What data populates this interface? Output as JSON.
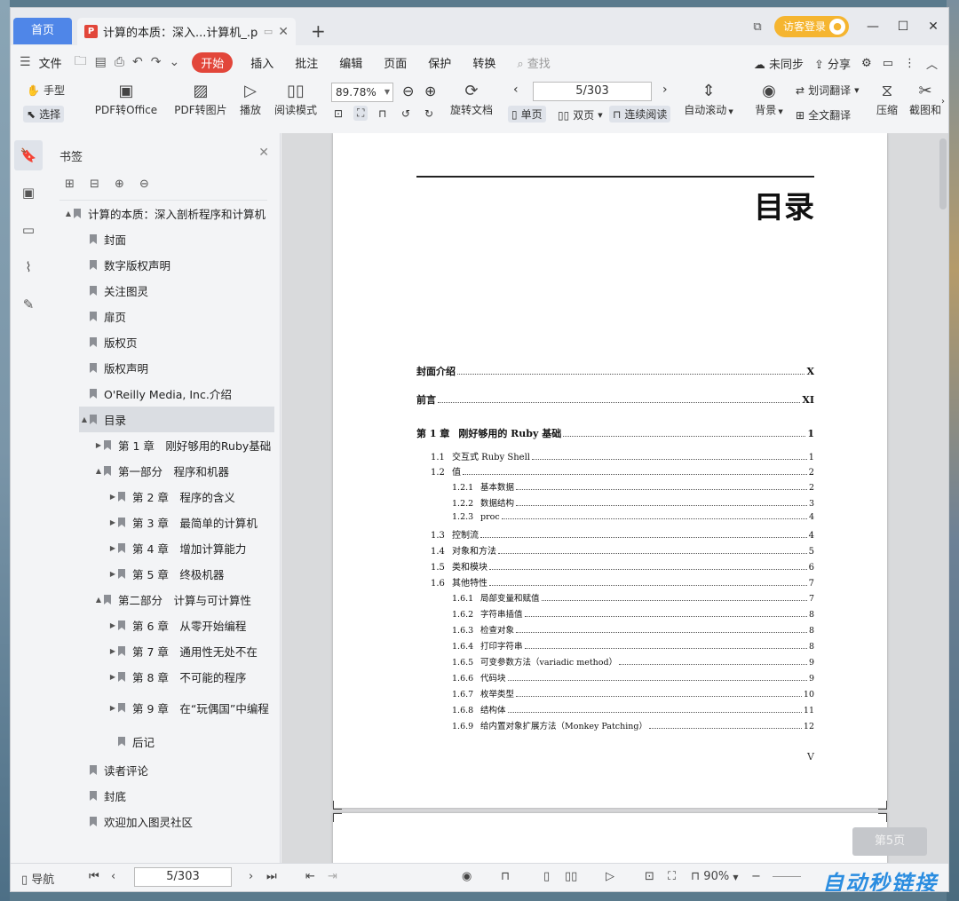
{
  "titlebar": {
    "home_tab": "首页",
    "doc_tab_title": "计算的本质：深入...计算机_.pdf",
    "pdf_icon": "pdf-icon",
    "login_label": "访客登录"
  },
  "menu": {
    "file": "文件",
    "start": "开始",
    "items": [
      "插入",
      "批注",
      "编辑",
      "页面",
      "保护",
      "转换"
    ],
    "search": "查找",
    "sync": "未同步",
    "share": "分享"
  },
  "toolbar": {
    "hand": "手型",
    "select": "选择",
    "pdf_to_office": "PDF转Office",
    "pdf_to_image": "PDF转图片",
    "play": "播放",
    "read_mode": "阅读模式",
    "zoom": "89.78%",
    "rotate": "旋转文档",
    "page_value": "5/303",
    "single": "单页",
    "double": "双页",
    "continuous": "连续阅读",
    "auto_scroll": "自动滚动",
    "background": "背景",
    "word_translate": "划词翻译",
    "full_translate": "全文翻译",
    "compress": "压缩",
    "screenshot": "截图和"
  },
  "sidebar": {
    "title": "书签",
    "tree": [
      {
        "label": "计算的本质：深入剖析程序和计算机",
        "level": 0,
        "arrow": "▲"
      },
      {
        "label": "封面",
        "level": 1,
        "arrow": ""
      },
      {
        "label": "数字版权声明",
        "level": 1,
        "arrow": ""
      },
      {
        "label": "关注图灵",
        "level": 1,
        "arrow": ""
      },
      {
        "label": "扉页",
        "level": 1,
        "arrow": ""
      },
      {
        "label": "版权页",
        "level": 1,
        "arrow": ""
      },
      {
        "label": "版权声明",
        "level": 1,
        "arrow": ""
      },
      {
        "label": "O'Reilly Media, Inc.介绍",
        "level": 1,
        "arrow": ""
      },
      {
        "label": "目录",
        "level": 1,
        "arrow": "▲",
        "selected": true
      },
      {
        "label": "第 1 章　刚好够用的Ruby基础",
        "level": 2,
        "arrow": "▶"
      },
      {
        "label": "第一部分　程序和机器",
        "level": 2,
        "arrow": "▲"
      },
      {
        "label": "第 2 章　程序的含义",
        "level": 3,
        "arrow": "▶"
      },
      {
        "label": "第 3 章　最简单的计算机",
        "level": 3,
        "arrow": "▶"
      },
      {
        "label": "第 4 章　增加计算能力",
        "level": 3,
        "arrow": "▶"
      },
      {
        "label": "第 5 章　终极机器",
        "level": 3,
        "arrow": "▶"
      },
      {
        "label": "第二部分　计算与可计算性",
        "level": 2,
        "arrow": "▲"
      },
      {
        "label": "第 6 章　从零开始编程",
        "level": 3,
        "arrow": "▶"
      },
      {
        "label": "第 7 章　通用性无处不在",
        "level": 3,
        "arrow": "▶"
      },
      {
        "label": "第 8 章　不可能的程序",
        "level": 3,
        "arrow": "▶"
      },
      {
        "label": "第 9 章　在“玩偶国”中编程",
        "level": 3,
        "arrow": "▶"
      },
      {
        "label": "后记",
        "level": 3,
        "arrow": ""
      },
      {
        "label": "读者评论",
        "level": 1,
        "arrow": ""
      },
      {
        "label": "封底",
        "level": 1,
        "arrow": ""
      },
      {
        "label": "欢迎加入图灵社区",
        "level": 1,
        "arrow": ""
      }
    ]
  },
  "page": {
    "title": "目录",
    "toc": [
      {
        "level": 0,
        "num": "",
        "text": "封面介绍",
        "page": "X"
      },
      {
        "level": 0,
        "num": "",
        "text": "前言",
        "page": "XI"
      },
      {
        "level": 0,
        "num": "第 1 章",
        "text": "刚好够用的 Ruby 基础",
        "page": "1"
      },
      {
        "level": 1,
        "num": "1.1",
        "text": "交互式 Ruby Shell",
        "page": "1"
      },
      {
        "level": 1,
        "num": "1.2",
        "text": "值",
        "page": "2"
      },
      {
        "level": 2,
        "num": "1.2.1",
        "text": "基本数据",
        "page": "2"
      },
      {
        "level": 2,
        "num": "1.2.2",
        "text": "数据结构",
        "page": "3"
      },
      {
        "level": 2,
        "num": "1.2.3",
        "text": "proc",
        "page": "4"
      },
      {
        "level": 1,
        "num": "1.3",
        "text": "控制流",
        "page": "4"
      },
      {
        "level": 1,
        "num": "1.4",
        "text": "对象和方法",
        "page": "5"
      },
      {
        "level": 1,
        "num": "1.5",
        "text": "类和模块",
        "page": "6"
      },
      {
        "level": 1,
        "num": "1.6",
        "text": "其他特性",
        "page": "7"
      },
      {
        "level": 2,
        "num": "1.6.1",
        "text": "局部变量和赋值",
        "page": "7"
      },
      {
        "level": 2,
        "num": "1.6.2",
        "text": "字符串插值",
        "page": "8"
      },
      {
        "level": 2,
        "num": "1.6.3",
        "text": "检查对象",
        "page": "8"
      },
      {
        "level": 2,
        "num": "1.6.4",
        "text": "打印字符串",
        "page": "8"
      },
      {
        "level": 2,
        "num": "1.6.5",
        "text": "可变参数方法（variadic method）",
        "page": "9"
      },
      {
        "level": 2,
        "num": "1.6.6",
        "text": "代码块",
        "page": "9"
      },
      {
        "level": 2,
        "num": "1.6.7",
        "text": "枚举类型",
        "page": "10"
      },
      {
        "level": 2,
        "num": "1.6.8",
        "text": "结构体",
        "page": "11"
      },
      {
        "level": 2,
        "num": "1.6.9",
        "text": "给内置对象扩展方法（Monkey Patching）",
        "page": "12"
      }
    ],
    "footer_num": "V",
    "page_badge": "第5页"
  },
  "statusbar": {
    "nav": "导航",
    "page_value": "5/303",
    "zoom": "90%",
    "brand": "自动秒链接"
  }
}
